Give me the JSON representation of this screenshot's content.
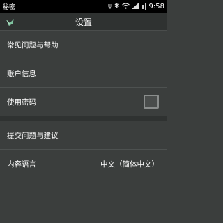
{
  "status_bar": {
    "left_label": "秘密",
    "time": "9:58",
    "icons": [
      "usb-icon",
      "debug-icon",
      "wifi-icon",
      "signal-icon",
      "battery-icon"
    ]
  },
  "title_bar": {
    "app_icon": "bird-logo-icon",
    "title": "设置"
  },
  "settings": {
    "faq": "常见问题与帮助",
    "account_info": "账户信息",
    "use_password": "使用密码",
    "use_password_checked": false,
    "feedback": "提交问题与建议",
    "content_language": "内容语言",
    "content_language_value": "中文（简体中文）"
  }
}
